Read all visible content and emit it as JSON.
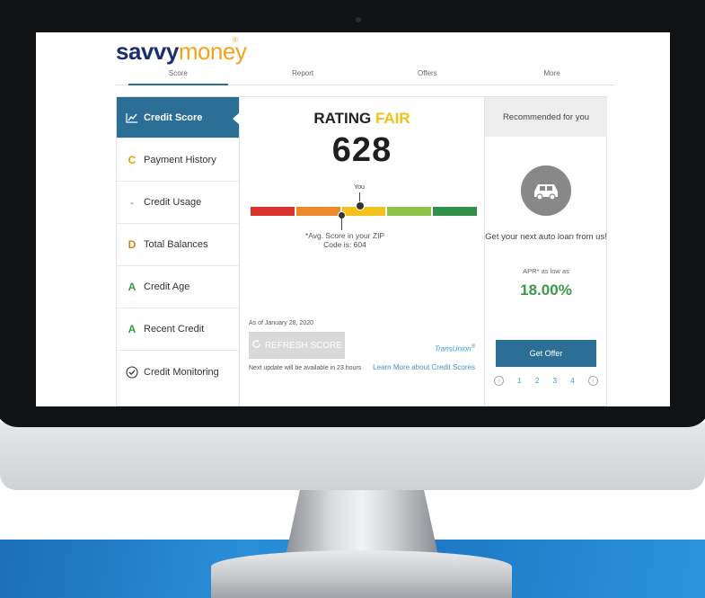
{
  "brand": {
    "name_a": "savvy",
    "name_b": "money",
    "mark": "®"
  },
  "nav": {
    "tabs": [
      {
        "label": "Score",
        "active": true
      },
      {
        "label": "Report"
      },
      {
        "label": "Offers"
      },
      {
        "label": "More"
      }
    ]
  },
  "sidebar": {
    "items": [
      {
        "label": "Credit Score",
        "grade": "",
        "icon": "trend-chart-icon",
        "active": true
      },
      {
        "label": "Payment History",
        "grade": "C"
      },
      {
        "label": "Credit Usage",
        "grade": "-"
      },
      {
        "label": "Total Balances",
        "grade": "D"
      },
      {
        "label": "Credit Age",
        "grade": "A"
      },
      {
        "label": "Recent Credit",
        "grade": "A"
      },
      {
        "label": "Credit Monitoring",
        "grade": "",
        "icon": "check-circle-icon"
      }
    ]
  },
  "score": {
    "rating_prefix": "RATING",
    "rating_value": "FAIR",
    "value": "628",
    "you_label": "You",
    "avg_text": "*Avg. Score in your ZIP Code is: 604",
    "bar_colors": [
      "#d8322b",
      "#ec8a2b",
      "#f2c21b",
      "#8fc249",
      "#2f8f4b"
    ],
    "as_of": "As of January 28, 2020",
    "refresh_label": "REFRESH SCORE",
    "next_update": "Next update will be available in 23 hours",
    "bureau": "TransUnion",
    "learn_more": "Learn More about Credit Scores"
  },
  "recommendation": {
    "header": "Recommended for you",
    "icon": "car-icon",
    "text": "Get your next auto loan from us!",
    "apr_label": "APR* as low as",
    "apr_value": "18.00%",
    "button": "Get Offer",
    "pages": [
      "1",
      "2",
      "3",
      "4"
    ]
  },
  "colors": {
    "accent": "#2b6f96",
    "fair": "#f2c21b",
    "green": "#3a9a47"
  }
}
